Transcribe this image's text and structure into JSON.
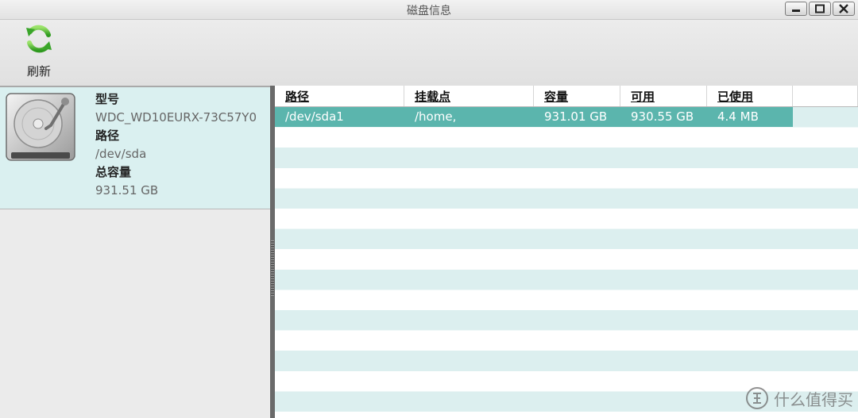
{
  "window": {
    "title": "磁盘信息",
    "buttons": [
      "minimize",
      "maximize",
      "close"
    ]
  },
  "toolbar": {
    "refresh_label": "刷新",
    "refresh_icon": "refresh-icon"
  },
  "disk": {
    "icon": "hard-drive-icon",
    "model_label": "型号",
    "model_value": "WDC_WD10EURX-73C57Y0",
    "path_label": "路径",
    "path_value": "/dev/sda",
    "capacity_label": "总容量",
    "capacity_value": "931.51 GB"
  },
  "table": {
    "columns": [
      "路径",
      "挂载点",
      "容量",
      "可用",
      "已使用"
    ],
    "rows": [
      [
        "/dev/sda1",
        "/home,",
        "931.01 GB",
        "930.55 GB",
        "4.4 MB"
      ]
    ],
    "selected_row_color": "#5bb5ad",
    "stripe_color": "#dcefef"
  },
  "watermark": {
    "text": "什么值得买",
    "icon": "zhi-logo-icon"
  }
}
